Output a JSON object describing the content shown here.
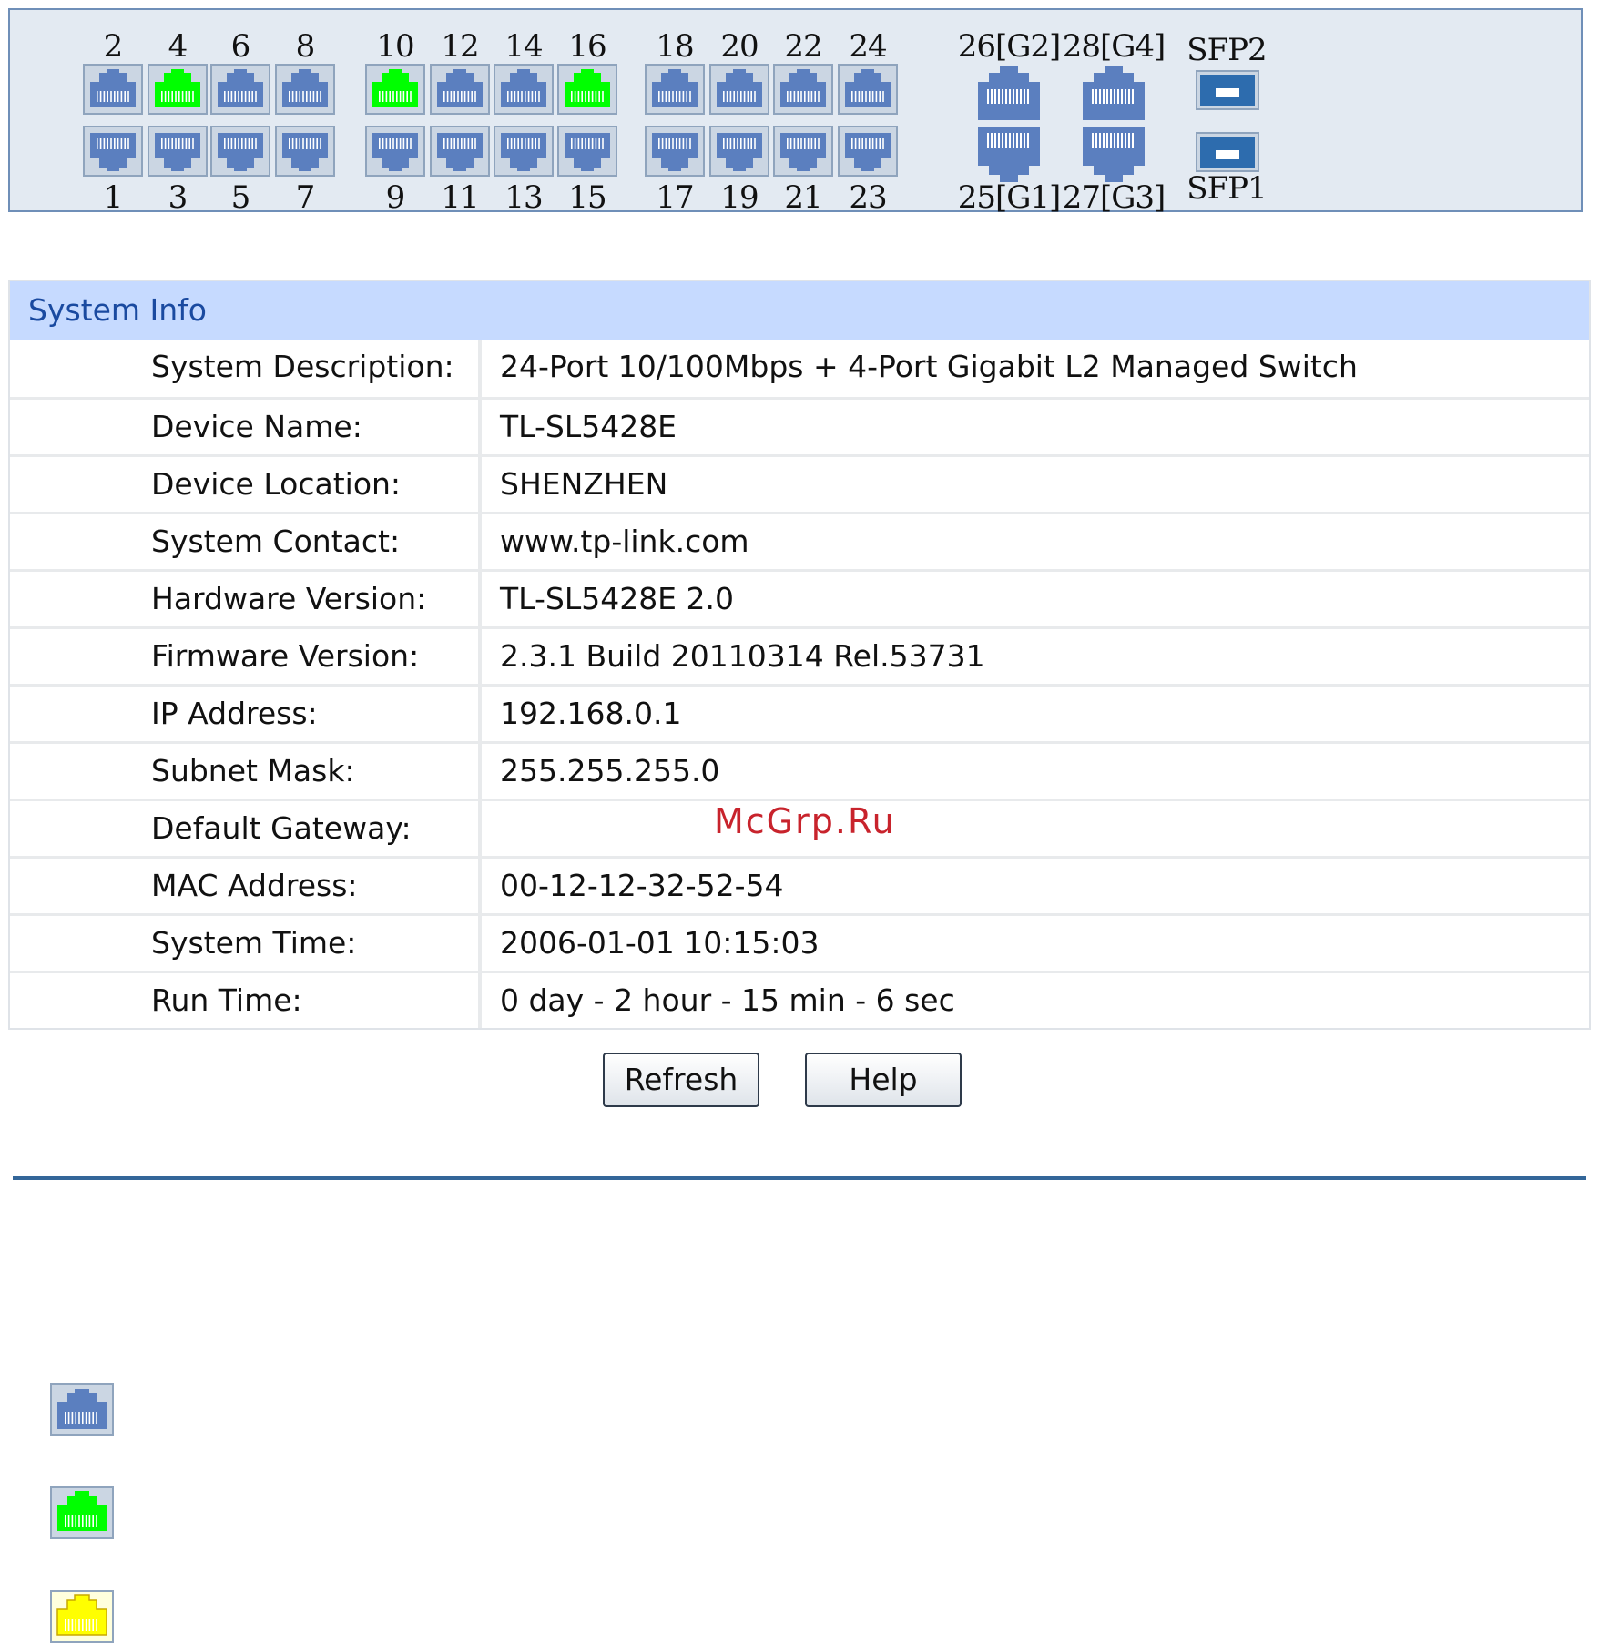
{
  "ports": {
    "top_row": [
      {
        "label": "2",
        "status": "normal"
      },
      {
        "label": "4",
        "status": "active"
      },
      {
        "label": "6",
        "status": "normal"
      },
      {
        "label": "8",
        "status": "normal"
      },
      {
        "label": "10",
        "status": "active"
      },
      {
        "label": "12",
        "status": "normal"
      },
      {
        "label": "14",
        "status": "normal"
      },
      {
        "label": "16",
        "status": "active"
      },
      {
        "label": "18",
        "status": "normal"
      },
      {
        "label": "20",
        "status": "normal"
      },
      {
        "label": "22",
        "status": "normal"
      },
      {
        "label": "24",
        "status": "normal"
      }
    ],
    "bottom_row": [
      {
        "label": "1",
        "status": "normal"
      },
      {
        "label": "3",
        "status": "normal"
      },
      {
        "label": "5",
        "status": "normal"
      },
      {
        "label": "7",
        "status": "normal"
      },
      {
        "label": "9",
        "status": "normal"
      },
      {
        "label": "11",
        "status": "normal"
      },
      {
        "label": "13",
        "status": "normal"
      },
      {
        "label": "15",
        "status": "normal"
      },
      {
        "label": "17",
        "status": "normal"
      },
      {
        "label": "19",
        "status": "normal"
      },
      {
        "label": "21",
        "status": "normal"
      },
      {
        "label": "23",
        "status": "normal"
      }
    ],
    "gigabit_top": [
      {
        "label": "26[G2]",
        "status": "normal"
      },
      {
        "label": "28[G4]",
        "status": "normal"
      }
    ],
    "gigabit_bottom": [
      {
        "label": "25[G1]",
        "status": "normal"
      },
      {
        "label": "27[G3]",
        "status": "normal"
      }
    ],
    "sfp_top": {
      "label": "SFP2"
    },
    "sfp_bottom": {
      "label": "SFP1"
    }
  },
  "colors": {
    "port_normal": "#5b7fbf",
    "port_active": "#00ff00",
    "port_yellow": "#ffff00",
    "header_bg": "#c6daff",
    "header_text": "#1a4aa0"
  },
  "system_info": {
    "title": "System Info",
    "rows": [
      {
        "label": "System Description:",
        "value": "24-Port 10/100Mbps + 4-Port Gigabit L2 Managed Switch"
      },
      {
        "label": "Device Name:",
        "value": "TL-SL5428E"
      },
      {
        "label": "Device Location:",
        "value": "SHENZHEN"
      },
      {
        "label": "System Contact:",
        "value": "www.tp-link.com"
      },
      {
        "label": "Hardware Version:",
        "value": "TL-SL5428E 2.0"
      },
      {
        "label": "Firmware Version:",
        "value": "2.3.1 Build 20110314 Rel.53731"
      },
      {
        "label": "IP Address:",
        "value": "192.168.0.1"
      },
      {
        "label": "Subnet Mask:",
        "value": "255.255.255.0"
      },
      {
        "label": "Default Gateway:",
        "value": ""
      },
      {
        "label": "MAC Address:",
        "value": "00-12-12-32-52-54"
      },
      {
        "label": "System Time:",
        "value": "2006-01-01 10:15:03"
      },
      {
        "label": "Run Time:",
        "value": "0 day - 2 hour - 15 min - 6 sec"
      }
    ]
  },
  "buttons": {
    "refresh_label": "Refresh",
    "help_label": "Help"
  },
  "watermark": "McGrp.Ru",
  "legend": [
    {
      "icon": "port-normal-icon",
      "status": "normal"
    },
    {
      "icon": "port-active-icon",
      "status": "active"
    },
    {
      "icon": "port-yellow-icon",
      "status": "yellow"
    }
  ]
}
